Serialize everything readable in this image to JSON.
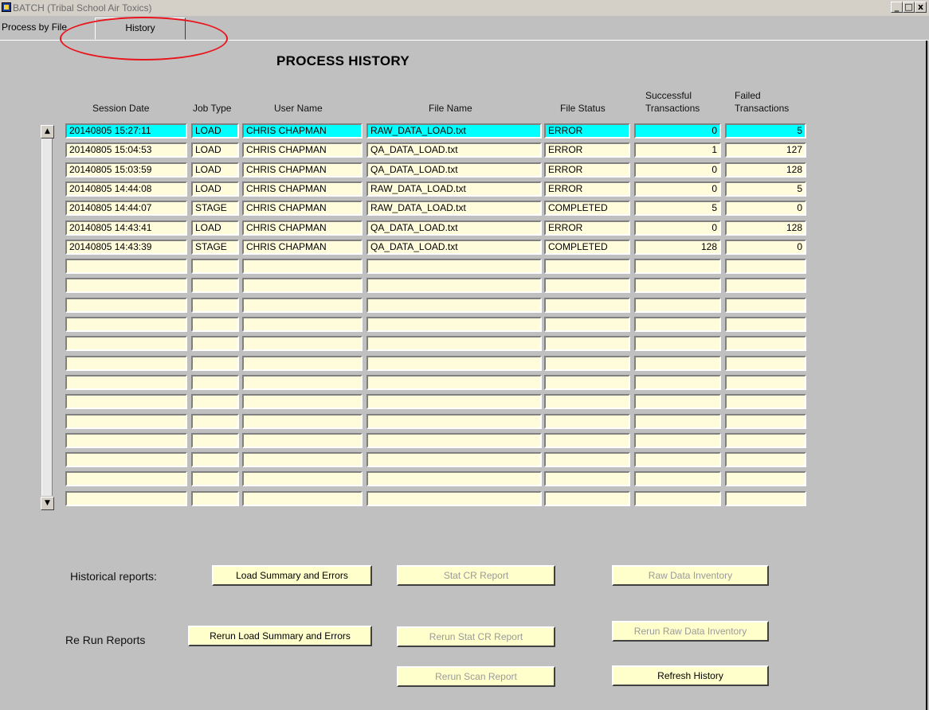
{
  "window": {
    "title": "BATCH (Tribal School Air Toxics)",
    "minimize_glyph": "_",
    "maximize_glyph": "□",
    "close_glyph": "x"
  },
  "tabs": [
    {
      "label": "Process by File"
    },
    {
      "label": "History"
    }
  ],
  "page_title": "PROCESS HISTORY",
  "columns": {
    "session_date": "Session Date",
    "job_type": "Job Type",
    "user_name": "User Name",
    "file_name": "File Name",
    "file_status": "File Status",
    "successful_l1": "Successful",
    "successful_l2": "Transactions",
    "failed_l1": "Failed",
    "failed_l2": "Transactions"
  },
  "scrollbar": {
    "up_glyph": "▲",
    "down_glyph": "▼"
  },
  "rows": [
    {
      "date": "20140805 15:27:11",
      "job": "LOAD",
      "user": "CHRIS CHAPMAN",
      "file": "RAW_DATA_LOAD.txt",
      "status": "ERROR",
      "success": "0",
      "failed": "5"
    },
    {
      "date": "20140805 15:04:53",
      "job": "LOAD",
      "user": "CHRIS CHAPMAN",
      "file": "QA_DATA_LOAD.txt",
      "status": "ERROR",
      "success": "1",
      "failed": "127"
    },
    {
      "date": "20140805 15:03:59",
      "job": "LOAD",
      "user": "CHRIS CHAPMAN",
      "file": "QA_DATA_LOAD.txt",
      "status": "ERROR",
      "success": "0",
      "failed": "128"
    },
    {
      "date": "20140805 14:44:08",
      "job": "LOAD",
      "user": "CHRIS CHAPMAN",
      "file": "RAW_DATA_LOAD.txt",
      "status": "ERROR",
      "success": "0",
      "failed": "5"
    },
    {
      "date": "20140805 14:44:07",
      "job": "STAGE",
      "user": "CHRIS CHAPMAN",
      "file": "RAW_DATA_LOAD.txt",
      "status": "COMPLETED",
      "success": "5",
      "failed": "0"
    },
    {
      "date": "20140805 14:43:41",
      "job": "LOAD",
      "user": "CHRIS CHAPMAN",
      "file": "QA_DATA_LOAD.txt",
      "status": "ERROR",
      "success": "0",
      "failed": "128"
    },
    {
      "date": "20140805 14:43:39",
      "job": "STAGE",
      "user": "CHRIS CHAPMAN",
      "file": "QA_DATA_LOAD.txt",
      "status": "COMPLETED",
      "success": "128",
      "failed": "0"
    },
    {
      "date": "",
      "job": "",
      "user": "",
      "file": "",
      "status": "",
      "success": "",
      "failed": ""
    },
    {
      "date": "",
      "job": "",
      "user": "",
      "file": "",
      "status": "",
      "success": "",
      "failed": ""
    },
    {
      "date": "",
      "job": "",
      "user": "",
      "file": "",
      "status": "",
      "success": "",
      "failed": ""
    },
    {
      "date": "",
      "job": "",
      "user": "",
      "file": "",
      "status": "",
      "success": "",
      "failed": ""
    },
    {
      "date": "",
      "job": "",
      "user": "",
      "file": "",
      "status": "",
      "success": "",
      "failed": ""
    },
    {
      "date": "",
      "job": "",
      "user": "",
      "file": "",
      "status": "",
      "success": "",
      "failed": ""
    },
    {
      "date": "",
      "job": "",
      "user": "",
      "file": "",
      "status": "",
      "success": "",
      "failed": ""
    },
    {
      "date": "",
      "job": "",
      "user": "",
      "file": "",
      "status": "",
      "success": "",
      "failed": ""
    },
    {
      "date": "",
      "job": "",
      "user": "",
      "file": "",
      "status": "",
      "success": "",
      "failed": ""
    },
    {
      "date": "",
      "job": "",
      "user": "",
      "file": "",
      "status": "",
      "success": "",
      "failed": ""
    },
    {
      "date": "",
      "job": "",
      "user": "",
      "file": "",
      "status": "",
      "success": "",
      "failed": ""
    },
    {
      "date": "",
      "job": "",
      "user": "",
      "file": "",
      "status": "",
      "success": "",
      "failed": ""
    },
    {
      "date": "",
      "job": "",
      "user": "",
      "file": "",
      "status": "",
      "success": "",
      "failed": ""
    }
  ],
  "reports": {
    "historical_label": "Historical reports:",
    "rerun_label": "Re Run Reports",
    "load_summary": "Load Summary and Errors",
    "stat_cr": "Stat CR Report",
    "raw_inventory": "Raw Data Inventory",
    "rerun_load_summary": "Rerun Load Summary and Errors",
    "rerun_stat_cr": "Rerun Stat CR Report",
    "rerun_raw_inventory": "Rerun Raw Data Inventory",
    "rerun_scan": "Rerun Scan Report",
    "refresh_history": "Refresh History"
  }
}
